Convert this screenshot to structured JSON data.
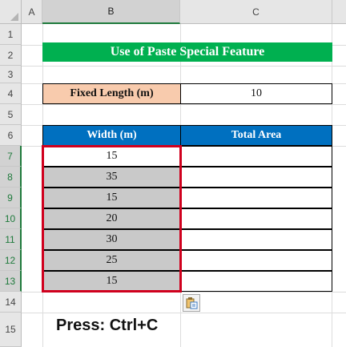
{
  "columns": [
    "A",
    "B",
    "C"
  ],
  "rows": [
    "1",
    "2",
    "3",
    "4",
    "5",
    "6",
    "7",
    "8",
    "9",
    "10",
    "11",
    "12",
    "13",
    "14",
    "15"
  ],
  "title": "Use of Paste Special Feature",
  "fixed_length": {
    "label": "Fixed Length (m)",
    "value": "10"
  },
  "table": {
    "headers": [
      "Width (m)",
      "Total Area"
    ],
    "widths": [
      "15",
      "35",
      "15",
      "20",
      "30",
      "25",
      "15"
    ]
  },
  "instruction": "Press: Ctrl+C",
  "icons": {
    "paste_options": "paste-options-icon"
  },
  "colors": {
    "title_bg": "#00b050",
    "label_bg": "#f8cbad",
    "header_bg": "#0070c0",
    "selection_fill": "#c9c9c9",
    "copy_border": "#d0001d"
  }
}
